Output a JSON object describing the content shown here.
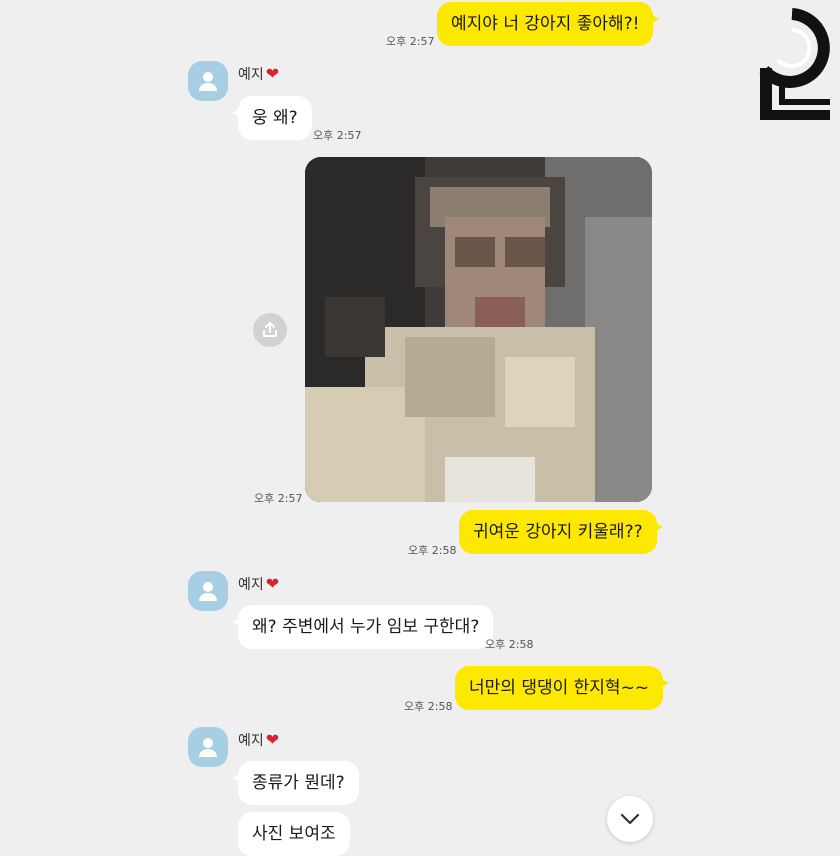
{
  "chat": {
    "contact_name": "예지",
    "contact_heart": "❤",
    "messages": [
      {
        "id": "m1",
        "side": "me",
        "text": "예지야 너 강아지 좋아해?!",
        "time": "오후 2:57"
      },
      {
        "id": "m2",
        "side": "them",
        "text": "웅 왜?",
        "time": "오후 2:57"
      },
      {
        "id": "m3",
        "side": "them",
        "type": "photo",
        "time": "오후 2:57"
      },
      {
        "id": "m4",
        "side": "me",
        "text": "귀여운 강아지 키울래??",
        "time": "오후 2:58"
      },
      {
        "id": "m5",
        "side": "them",
        "text": "왜? 주변에서 누가 임보 구한대?",
        "time": "오후 2:58"
      },
      {
        "id": "m6",
        "side": "me",
        "text": "너만의 댕댕이 한지혁~~",
        "time": "오후 2:58"
      },
      {
        "id": "m7",
        "side": "them",
        "text": "종류가 뭔데?"
      },
      {
        "id": "m8",
        "side": "them",
        "text": "사진 보여조"
      }
    ]
  },
  "icons": {
    "avatar": "person-silhouette-icon",
    "share": "share-upload-icon",
    "scroll": "chevron-down-icon",
    "logo": "channel-logo"
  },
  "colors": {
    "background": "#efefef",
    "my_bubble": "#fde800",
    "their_bubble": "#ffffff",
    "avatar_bg": "#a6cfe3",
    "heart": "#e0202a"
  }
}
